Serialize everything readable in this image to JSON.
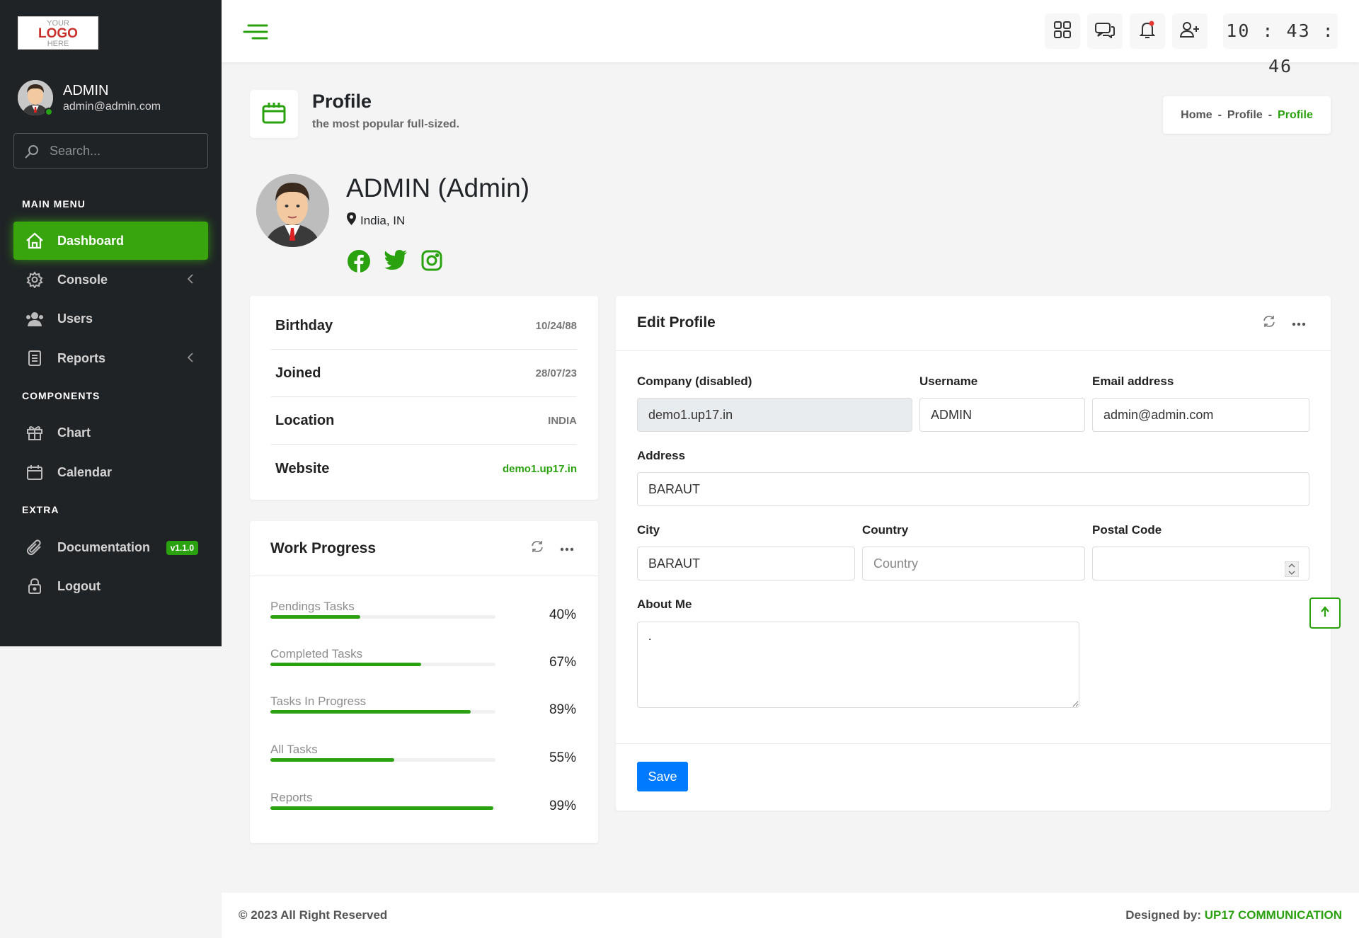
{
  "logo": {
    "line1": "YOUR",
    "line2": "LOGO",
    "line3": "HERE"
  },
  "user": {
    "name": "ADMIN",
    "email": "admin@admin.com"
  },
  "search": {
    "placeholder": "Search..."
  },
  "sidebar": {
    "sections": [
      "MAIN MENU",
      "COMPONENTS",
      "EXTRA"
    ],
    "items": [
      {
        "label": "Dashboard",
        "icon": "home-icon"
      },
      {
        "label": "Console",
        "icon": "gear-icon"
      },
      {
        "label": "Users",
        "icon": "users-icon"
      },
      {
        "label": "Reports",
        "icon": "report-icon"
      },
      {
        "label": "Chart",
        "icon": "gift-icon"
      },
      {
        "label": "Calendar",
        "icon": "calendar-icon"
      },
      {
        "label": "Documentation",
        "icon": "paperclip-icon",
        "badge": "v1.1.0"
      },
      {
        "label": "Logout",
        "icon": "lock-icon"
      }
    ]
  },
  "header": {
    "clock": "10 : 43 : 46"
  },
  "page": {
    "title": "Profile",
    "subtitle": "the most popular full-sized."
  },
  "breadcrumb": {
    "items": [
      "Home",
      "Profile",
      "Profile"
    ],
    "separator": "-"
  },
  "profile": {
    "name": "ADMIN (Admin)",
    "location": "India, IN"
  },
  "info": [
    {
      "label": "Birthday",
      "value": "10/24/88"
    },
    {
      "label": "Joined",
      "value": "28/07/23"
    },
    {
      "label": "Location",
      "value": "INDIA"
    },
    {
      "label": "Website",
      "value": "demo1.up17.in"
    }
  ],
  "work_progress": {
    "title": "Work Progress",
    "items": [
      {
        "label": "Pendings Tasks",
        "value": "40%",
        "fraction": 0.4
      },
      {
        "label": "Completed Tasks",
        "value": "67%",
        "fraction": 0.67
      },
      {
        "label": "Tasks In Progress",
        "value": "89%",
        "fraction": 0.89
      },
      {
        "label": "All Tasks",
        "value": "55%",
        "fraction": 0.55
      },
      {
        "label": "Reports",
        "value": "99%",
        "fraction": 0.99
      }
    ]
  },
  "edit": {
    "title": "Edit Profile",
    "company_label": "Company (disabled)",
    "company_value": "demo1.up17.in",
    "username_label": "Username",
    "username_value": "ADMIN",
    "email_label": "Email address",
    "email_value": "admin@admin.com",
    "address_label": "Address",
    "address_value": "BARAUT",
    "city_label": "City",
    "city_value": "BARAUT",
    "country_label": "Country",
    "country_placeholder": "Country",
    "postal_label": "Postal Code",
    "postal_value": "",
    "about_label": "About Me",
    "about_value": ".",
    "save_label": "Save"
  },
  "footer": {
    "copyright": "© 2023 All Right Reserved",
    "designed_by": "Designed by: ",
    "brand": "UP17 COMMUNICATION"
  },
  "colors": {
    "accent": "#2aa10f",
    "sidebar": "#1f2326",
    "primary_button": "#007bff"
  }
}
